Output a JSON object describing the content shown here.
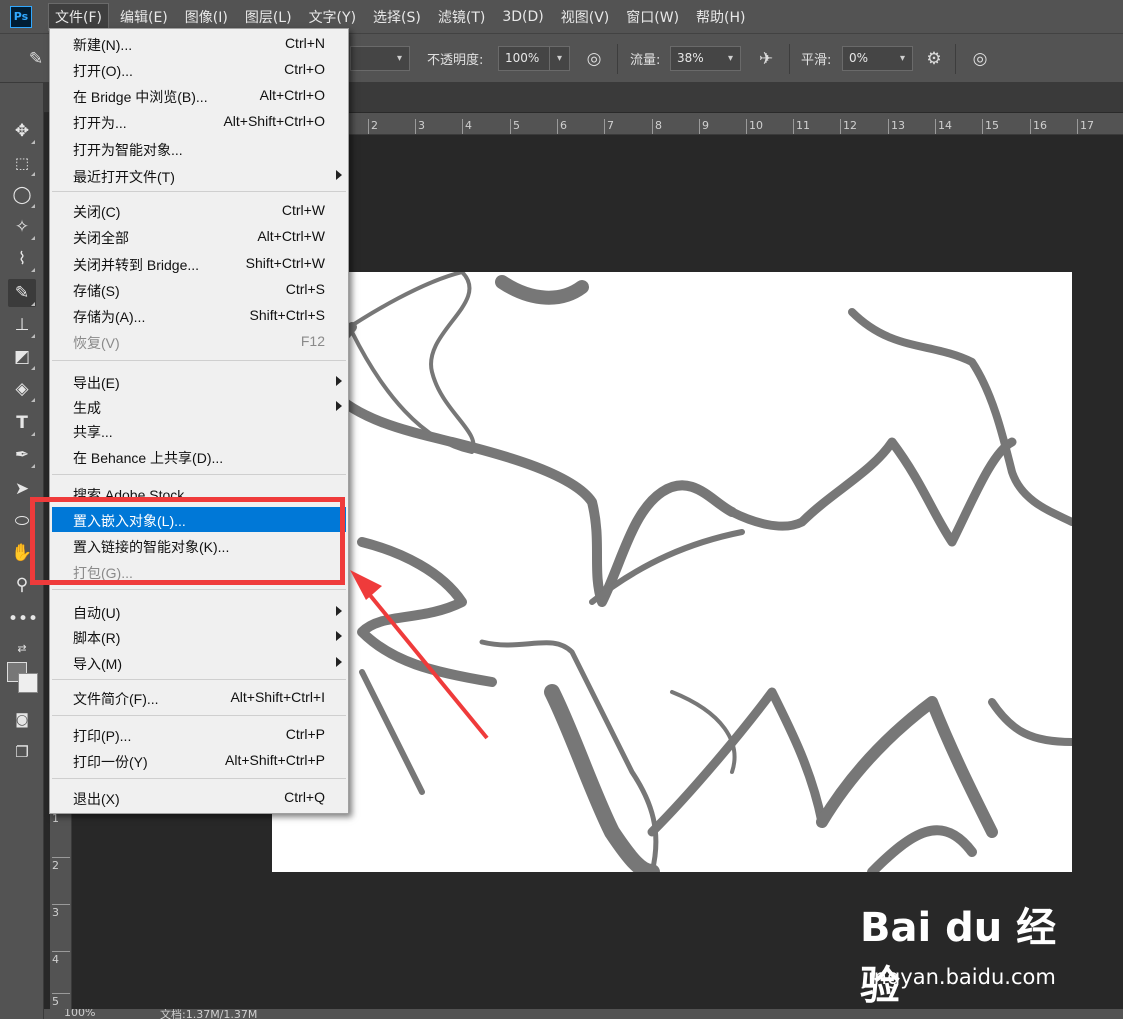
{
  "app": {
    "logo": "Ps",
    "menubar": [
      "文件(F)",
      "编辑(E)",
      "图像(I)",
      "图层(L)",
      "文字(Y)",
      "选择(S)",
      "滤镜(T)",
      "3D(D)",
      "视图(V)",
      "窗口(W)",
      "帮助(H)"
    ],
    "active_menu": "文件(F)"
  },
  "options": {
    "opacity_label": "不透明度:",
    "opacity_value": "100%",
    "flow_label": "流量:",
    "flow_value": "38%",
    "smoothing_label": "平滑:",
    "smoothing_value": "0%"
  },
  "rulers": {
    "top_ticks": [
      "2",
      "3",
      "4",
      "5",
      "6",
      "7",
      "8",
      "9",
      "10",
      "11",
      "12",
      "13",
      "14",
      "15",
      "16",
      "17"
    ],
    "left_ticks": [
      "1",
      "2",
      "3",
      "4",
      "5"
    ]
  },
  "file_menu": {
    "items": [
      {
        "label": "新建(N)...",
        "shortcut": "Ctrl+N"
      },
      {
        "label": "打开(O)...",
        "shortcut": "Ctrl+O"
      },
      {
        "label": "在 Bridge 中浏览(B)...",
        "shortcut": "Alt+Ctrl+O"
      },
      {
        "label": "打开为...",
        "shortcut": "Alt+Shift+Ctrl+O"
      },
      {
        "label": "打开为智能对象...",
        "shortcut": ""
      },
      {
        "label": "最近打开文件(T)",
        "shortcut": "",
        "submenu": true
      },
      {
        "label": "关闭(C)",
        "shortcut": "Ctrl+W"
      },
      {
        "label": "关闭全部",
        "shortcut": "Alt+Ctrl+W"
      },
      {
        "label": "关闭并转到 Bridge...",
        "shortcut": "Shift+Ctrl+W"
      },
      {
        "label": "存储(S)",
        "shortcut": "Ctrl+S"
      },
      {
        "label": "存储为(A)...",
        "shortcut": "Shift+Ctrl+S"
      },
      {
        "label": "恢复(V)",
        "shortcut": "F12",
        "disabled": true
      },
      {
        "label": "导出(E)",
        "shortcut": "",
        "submenu": true
      },
      {
        "label": "生成",
        "shortcut": "",
        "submenu": true
      },
      {
        "label": "共享...",
        "shortcut": ""
      },
      {
        "label": "在 Behance 上共享(D)...",
        "shortcut": ""
      },
      {
        "label": "搜索 Adobe Stock...",
        "shortcut": ""
      },
      {
        "label": "置入嵌入对象(L)...",
        "shortcut": "",
        "highlighted": true
      },
      {
        "label": "置入链接的智能对象(K)...",
        "shortcut": ""
      },
      {
        "label": "打包(G)...",
        "shortcut": "",
        "disabled": true
      },
      {
        "label": "自动(U)",
        "shortcut": "",
        "submenu": true
      },
      {
        "label": "脚本(R)",
        "shortcut": "",
        "submenu": true
      },
      {
        "label": "导入(M)",
        "shortcut": "",
        "submenu": true
      },
      {
        "label": "文件简介(F)...",
        "shortcut": "Alt+Shift+Ctrl+I"
      },
      {
        "label": "打印(P)...",
        "shortcut": "Ctrl+P"
      },
      {
        "label": "打印一份(Y)",
        "shortcut": "Alt+Shift+Ctrl+P"
      },
      {
        "label": "退出(X)",
        "shortcut": "Ctrl+Q"
      }
    ]
  },
  "status": {
    "zoom": "100%",
    "doc": "文档:1.37M/1.37M"
  },
  "watermark": {
    "logo": "Bai du 经验",
    "url": "jingyan.baidu.com"
  },
  "colors": {
    "highlight_box": "#ef3b3b",
    "menu_highlight": "#0078d7"
  }
}
